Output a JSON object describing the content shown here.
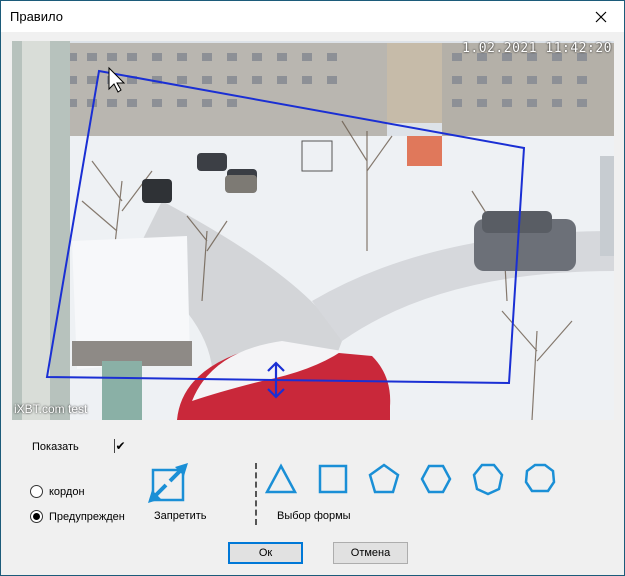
{
  "window": {
    "title": "Правило"
  },
  "camera": {
    "timestamp": "1.02.2021 11:42:20",
    "watermark": "iXBT.com test"
  },
  "show": {
    "label": "Показать",
    "checkmark": "✔"
  },
  "mode": {
    "options": [
      {
        "label": "кордон",
        "selected": false
      },
      {
        "label": "Предупрежден",
        "selected": true
      }
    ]
  },
  "deny": {
    "label": "Запретить"
  },
  "shapes": {
    "label": "Выбор формы",
    "items": [
      "triangle-icon",
      "square-icon",
      "pentagon-icon",
      "hexagon-icon",
      "hexagon-icon",
      "heptagon-icon"
    ],
    "color": "#1a8fd6"
  },
  "buttons": {
    "ok": "Ок",
    "cancel": "Отмена"
  }
}
